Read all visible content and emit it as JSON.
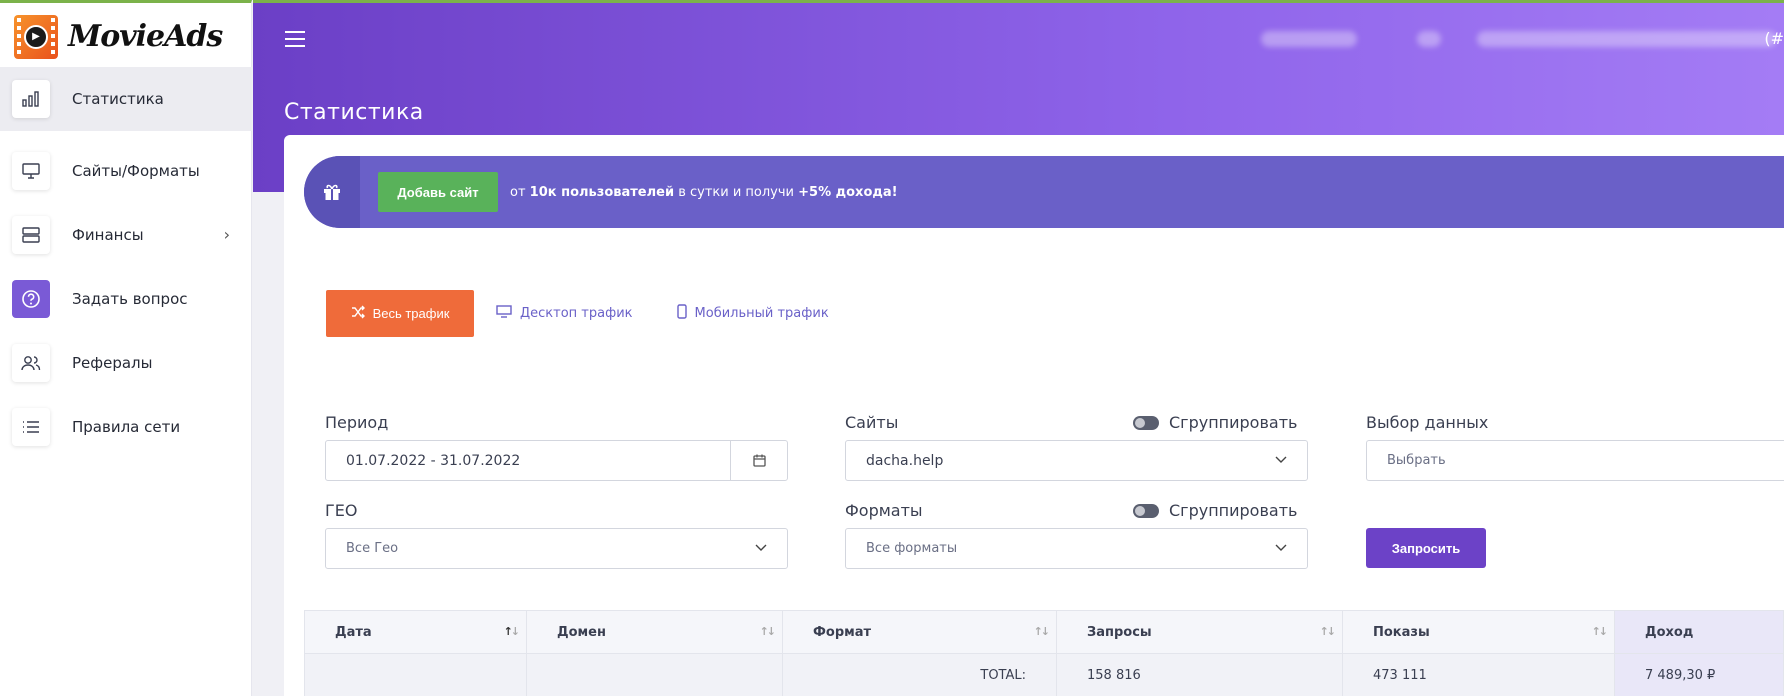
{
  "brand": {
    "name": "MovieAds"
  },
  "sidebar": {
    "items": [
      {
        "label": "Статистика"
      },
      {
        "label": "Сайты/Форматы"
      },
      {
        "label": "Финансы"
      },
      {
        "label": "Задать вопрос"
      },
      {
        "label": "Рефералы"
      },
      {
        "label": "Правила сети"
      }
    ]
  },
  "header": {
    "page_title": "Статистика",
    "right_mark": "(#"
  },
  "promo": {
    "button_label": "Добавь сайт",
    "text_pre": "от ",
    "text_bold1": "10к пользователей",
    "text_mid": " в сутки и получи ",
    "text_bold2": "+5% дохода!"
  },
  "traffic_tabs": [
    {
      "label": "Весь трафик"
    },
    {
      "label": "Десктоп трафик"
    },
    {
      "label": "Мобильный трафик"
    }
  ],
  "filters": {
    "period_label": "Период",
    "period_value": "01.07.2022 - 31.07.2022",
    "sites_label": "Сайты",
    "sites_value": "dacha.help",
    "group_label": "Сгруппировать",
    "data_label": "Выбор данных",
    "data_placeholder": "Выбрать",
    "geo_label": "ГЕО",
    "geo_value": "Все Гео",
    "formats_label": "Форматы",
    "formats_value": "Все форматы",
    "submit_label": "Запросить"
  },
  "table": {
    "columns": [
      "Дата",
      "Домен",
      "Формат",
      "Запросы",
      "Показы",
      "Доход"
    ],
    "total_label": "TOTAL:",
    "totals": {
      "requests": "158 816",
      "impressions": "473 111",
      "income": "7 489,30 ₽"
    }
  },
  "colors": {
    "accent": "#6c42c7",
    "orange": "#ef6b3a",
    "green": "#59b25a",
    "promo": "#6a60c8"
  }
}
